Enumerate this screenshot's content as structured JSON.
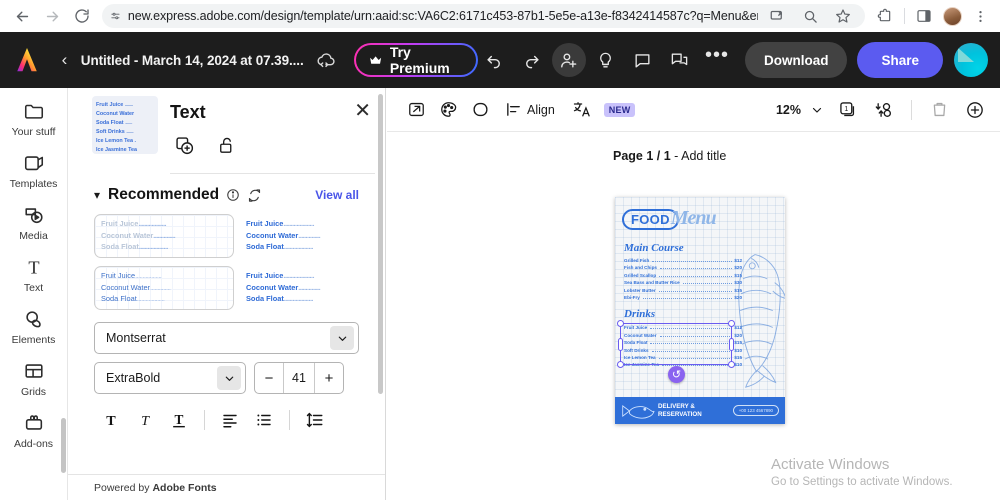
{
  "browser": {
    "url": "new.express.adobe.com/design/template/urn:aaid:sc:VA6C2:6171c453-87b1-5e5e-a13e-f8342414587c?q=Menu&entryPoint=template&taskID=menu",
    "back_icon": "back-arrow-icon",
    "forward_icon": "forward-arrow-icon",
    "reload_icon": "reload-icon",
    "site_settings_icon": "tune-icon",
    "cast_icon": "cast-icon",
    "zoom_icon": "zoom-icon",
    "bookmark_icon": "star-icon",
    "extensions_icon": "extensions-icon",
    "sidepanel_icon": "side-panel-icon",
    "menu_icon": "kebab-menu-icon"
  },
  "header": {
    "logo": "adobe-express-logo",
    "back_label": "‹",
    "doc_title": "Untitled - March 14, 2024 at 07.39....",
    "cloud_icon": "cloud-sync-icon",
    "try_premium": "Try Premium",
    "crown_icon": "crown-icon",
    "undo_icon": "undo-icon",
    "redo_icon": "redo-icon",
    "invite_icon": "add-person-icon",
    "ideas_icon": "lightbulb-icon",
    "comment_icon": "comment-icon",
    "duplicate_icon": "duplicate-icon",
    "more_label": "•••",
    "download": "Download",
    "share": "Share",
    "avatar": "user-avatar"
  },
  "rail": {
    "items": [
      {
        "label": "Your stuff",
        "icon": "folder-icon"
      },
      {
        "label": "Templates",
        "icon": "templates-icon"
      },
      {
        "label": "Media",
        "icon": "media-icon"
      },
      {
        "label": "Text",
        "icon": "text-icon"
      },
      {
        "label": "Elements",
        "icon": "elements-icon"
      },
      {
        "label": "Grids",
        "icon": "grids-icon"
      },
      {
        "label": "Add-ons",
        "icon": "addons-icon"
      }
    ]
  },
  "panel": {
    "title": "Text",
    "close_icon": "close-icon",
    "duplicate_icon": "duplicate-text-icon",
    "lock_icon": "unlock-icon",
    "thumbnail": {
      "lines": [
        "Fruit Juice",
        "Coconut Water",
        "Soda Float",
        "Soft Drinks",
        "Ice Lemon Tea .",
        "Ice Jasmine Tea"
      ]
    },
    "recommended": {
      "caret_icon": "chevron-down-icon",
      "title": "Recommended",
      "info_icon": "info-icon",
      "refresh_icon": "refresh-icon",
      "view_all": "View all"
    },
    "tiles": [
      {
        "lines": [
          "Fruit Juice",
          "Coconut Water",
          "Soda Float"
        ],
        "variant": "faint"
      },
      {
        "lines": [
          "Fruit Juice",
          "Coconut Water",
          "Soda Float"
        ],
        "variant": "plain"
      },
      {
        "lines": [
          "Fruit Juice",
          "Coconut Water",
          "Soda Float"
        ],
        "variant": "thin"
      },
      {
        "lines": [
          "Fruit Juice",
          "Coconut Water",
          "Soda Float"
        ],
        "variant": "bold"
      }
    ],
    "font": {
      "family": "Montserrat",
      "style": "ExtraBold",
      "size": "41",
      "minus": "−",
      "plus": "+",
      "caret_icon": "chevron-down-icon",
      "bold_icon": "bold-icon",
      "italic_icon": "italic-icon",
      "underline_icon": "underline-icon",
      "align_icon": "text-align-icon",
      "list_icon": "bullet-list-icon",
      "spacing_icon": "line-spacing-icon"
    },
    "powered_by_prefix": "Powered by",
    "powered_by_brand": "Adobe Fonts"
  },
  "canvas_toolbar": {
    "position_icon": "position-icon",
    "color_icon": "color-palette-icon",
    "shape_icon": "shape-icon",
    "align_icon": "align-icon",
    "align_label": "Align",
    "translate_icon": "translate-icon",
    "new_badge": "NEW",
    "annotation_arrow": "left-arrow-annotation",
    "zoom_value": "12%",
    "zoom_caret_icon": "chevron-down-icon",
    "pages_icon": "page-count-icon",
    "animate_icon": "animate-icon",
    "delete_icon": "trash-icon",
    "add_icon": "add-page-icon"
  },
  "canvas": {
    "page_label_bold": "Page 1 / 1",
    "page_label_rest": " - Add title"
  },
  "document": {
    "logo_pill": "FOOD",
    "logo_script": "Menu",
    "sections": [
      {
        "title": "Main Course",
        "items": [
          {
            "name": "Grilled Fish",
            "price": "$12"
          },
          {
            "name": "Fish and Chips",
            "price": "$20"
          },
          {
            "name": "Grilled Scallop",
            "price": "$15"
          },
          {
            "name": "Sea Bass and Butter Rice",
            "price": "$30"
          },
          {
            "name": "Lobster Butter",
            "price": "$15"
          },
          {
            "name": "Ebi-Fry",
            "price": "$20"
          }
        ]
      },
      {
        "title": "Drinks",
        "selected": true,
        "items": [
          {
            "name": "Fruit Juice",
            "price": "$12"
          },
          {
            "name": "Coconut Water",
            "price": "$20"
          },
          {
            "name": "Soda Float",
            "price": "$15"
          },
          {
            "name": "Soft Drinks",
            "price": "$10"
          },
          {
            "name": "Ice Lemon Tea",
            "price": "$15"
          },
          {
            "name": "Ice Jasmine Tea",
            "price": "$10"
          }
        ]
      }
    ],
    "footer_line1": "DELIVERY &",
    "footer_line2": "RESERVATION",
    "footer_phone": "+00 123 4567890",
    "fish_icon": "fish-illustration",
    "rotate_icon": "rotate-handle-icon"
  },
  "watermark": {
    "line1": "Activate Windows",
    "line2": "Go to Settings to activate Windows."
  },
  "colors": {
    "header_bg": "#1d1d1d",
    "share_blue": "#5b5bf0",
    "menu_blue": "#2f6fd8",
    "accent_link": "#4a55e8",
    "selection_purple": "#6a5cf0",
    "annotation_cyan": "#29c7d6"
  }
}
